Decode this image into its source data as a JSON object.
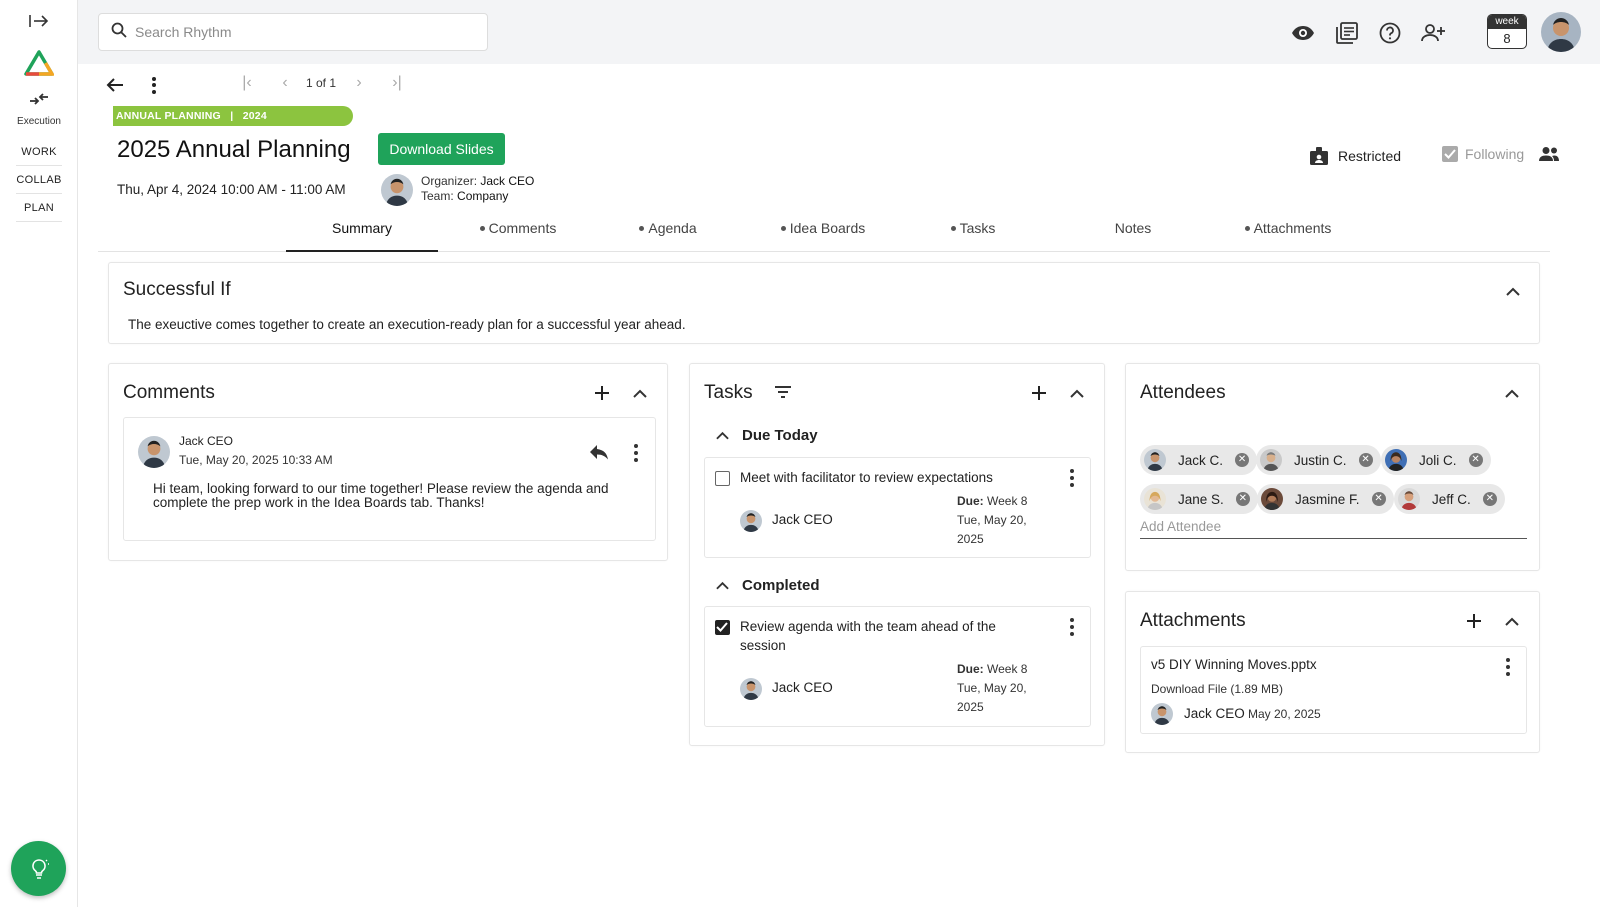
{
  "sidebar": {
    "execution_label": "Execution",
    "items": [
      {
        "label": "WORK"
      },
      {
        "label": "COLLAB"
      },
      {
        "label": "PLAN"
      }
    ]
  },
  "search": {
    "placeholder": "Search Rhythm"
  },
  "week": {
    "label": "week",
    "number": "8"
  },
  "pager": {
    "text": "1 of 1"
  },
  "meeting": {
    "banner": "ANNUAL PLANNING   |   2024",
    "title": "2025 Annual Planning",
    "download_label": "Download Slides",
    "datetime": "Thu, Apr 4, 2024 10:00 AM - 11:00 AM",
    "organizer_label": "Organizer:",
    "organizer": "Jack CEO",
    "team_label": "Team:",
    "team": "Company",
    "restricted_label": "Restricted",
    "following_label": "Following"
  },
  "tabs": [
    {
      "label": "Summary",
      "dot": false
    },
    {
      "label": "Comments",
      "dot": true
    },
    {
      "label": "Agenda",
      "dot": true
    },
    {
      "label": "Idea Boards",
      "dot": true
    },
    {
      "label": "Tasks",
      "dot": true
    },
    {
      "label": "Notes",
      "dot": false
    },
    {
      "label": "Attachments",
      "dot": true
    }
  ],
  "successful_if": {
    "title": "Successful If",
    "text": "The exeuctive comes together to create an execution-ready plan for a successful year ahead."
  },
  "comments": {
    "title": "Comments",
    "items": [
      {
        "author": "Jack CEO",
        "timestamp": "Tue, May 20, 2025 10:33 AM",
        "body": "Hi team, looking forward to our time together! Please review the agenda and complete the prep work in the Idea Boards tab. Thanks!"
      }
    ]
  },
  "tasks": {
    "title": "Tasks",
    "due_today_label": "Due Today",
    "completed_label": "Completed",
    "due_today": [
      {
        "text": "Meet with facilitator to review expectations",
        "owner": "Jack CEO",
        "due_label": "Due:",
        "due_week": "Week 8",
        "due_date_1": "Tue, May 20,",
        "due_date_2": "2025",
        "checked": false
      }
    ],
    "completed": [
      {
        "text": "Review agenda with the team ahead of the session",
        "owner": "Jack CEO",
        "due_label": "Due:",
        "due_week": "Week 8",
        "due_date_1": "Tue, May 20,",
        "due_date_2": "2025",
        "checked": true
      }
    ]
  },
  "attendees": {
    "title": "Attendees",
    "people": [
      "Jack C.",
      "Justin C.",
      "Joli C.",
      "Jane S.",
      "Jasmine F.",
      "Jeff C."
    ],
    "add_placeholder": "Add Attendee"
  },
  "attachments": {
    "title": "Attachments",
    "items": [
      {
        "filename": "v5 DIY Winning Moves.pptx",
        "download": "Download File (1.89 MB)",
        "owner": "Jack CEO",
        "date": "May 20, 2025"
      }
    ]
  },
  "colors": {
    "brand_green": "#1fa35a",
    "banner_green": "#8cc43f"
  }
}
